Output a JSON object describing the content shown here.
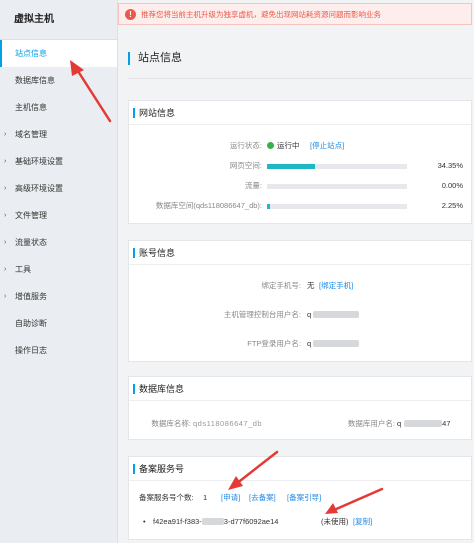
{
  "sidebar": {
    "title": "虚拟主机",
    "items": [
      {
        "label": "站点信息"
      },
      {
        "label": "数据库信息"
      },
      {
        "label": "主机信息"
      },
      {
        "label": "域名管理"
      },
      {
        "label": "基础环境设置"
      },
      {
        "label": "高级环境设置"
      },
      {
        "label": "文件管理"
      },
      {
        "label": "流量状态"
      },
      {
        "label": "工具"
      },
      {
        "label": "增值服务"
      },
      {
        "label": "自助诊断"
      },
      {
        "label": "操作日志"
      }
    ]
  },
  "notice": {
    "icon": "!",
    "text": "推荐您将当前主机升级为独享虚机，避免出现网站耗资源问题而影响业务"
  },
  "page_title": "站点信息",
  "site_info": {
    "title": "网站信息",
    "status_label": "运行状态:",
    "status_value": "运行中",
    "stop_link": "[停止站点]",
    "web_space_label": "网页空间:",
    "web_space_pct": "34.35%",
    "web_space_fraction": 0.3435,
    "traffic_label": "流量:",
    "traffic_pct": "0.00%",
    "traffic_fraction": 0.0,
    "db_space_label": "数据库空间(qds118086647_db):",
    "db_space_pct": "2.25%",
    "db_space_fraction": 0.0225
  },
  "account_info": {
    "title": "账号信息",
    "phone_label": "绑定手机号:",
    "phone_value": "无",
    "phone_link": "[绑定手机]",
    "console_user_label": "主机管理控制台用户名:",
    "console_user_value": "q",
    "ftp_user_label": "FTP登录用户名:",
    "ftp_user_value": "q"
  },
  "db_info": {
    "title": "数据库信息",
    "db_name_label": "数据库名称:",
    "db_name_value": "qds118086647_db",
    "db_user_label": "数据库用户名:",
    "db_user_value": "q",
    "db_user_suffix": "47"
  },
  "beian": {
    "title": "备案服务号",
    "count_label": "备案服务号个数:",
    "count_value": "1",
    "apply_link": "[申请]",
    "goto_link": "[去备案]",
    "guide_link": "[备案引导]",
    "code_prefix": "f42ea91f-f383-",
    "code_suffix": "3-d77f6092ae14",
    "code_status": "(未使用)",
    "copy_link": "[复制]"
  },
  "colors": {
    "accent": "#00a0e9",
    "link": "#1e88e5",
    "notice_red": "#e85b4b",
    "progress": "#1fb7c6",
    "running_green": "#35b34a",
    "annotation_red": "#e53935"
  }
}
